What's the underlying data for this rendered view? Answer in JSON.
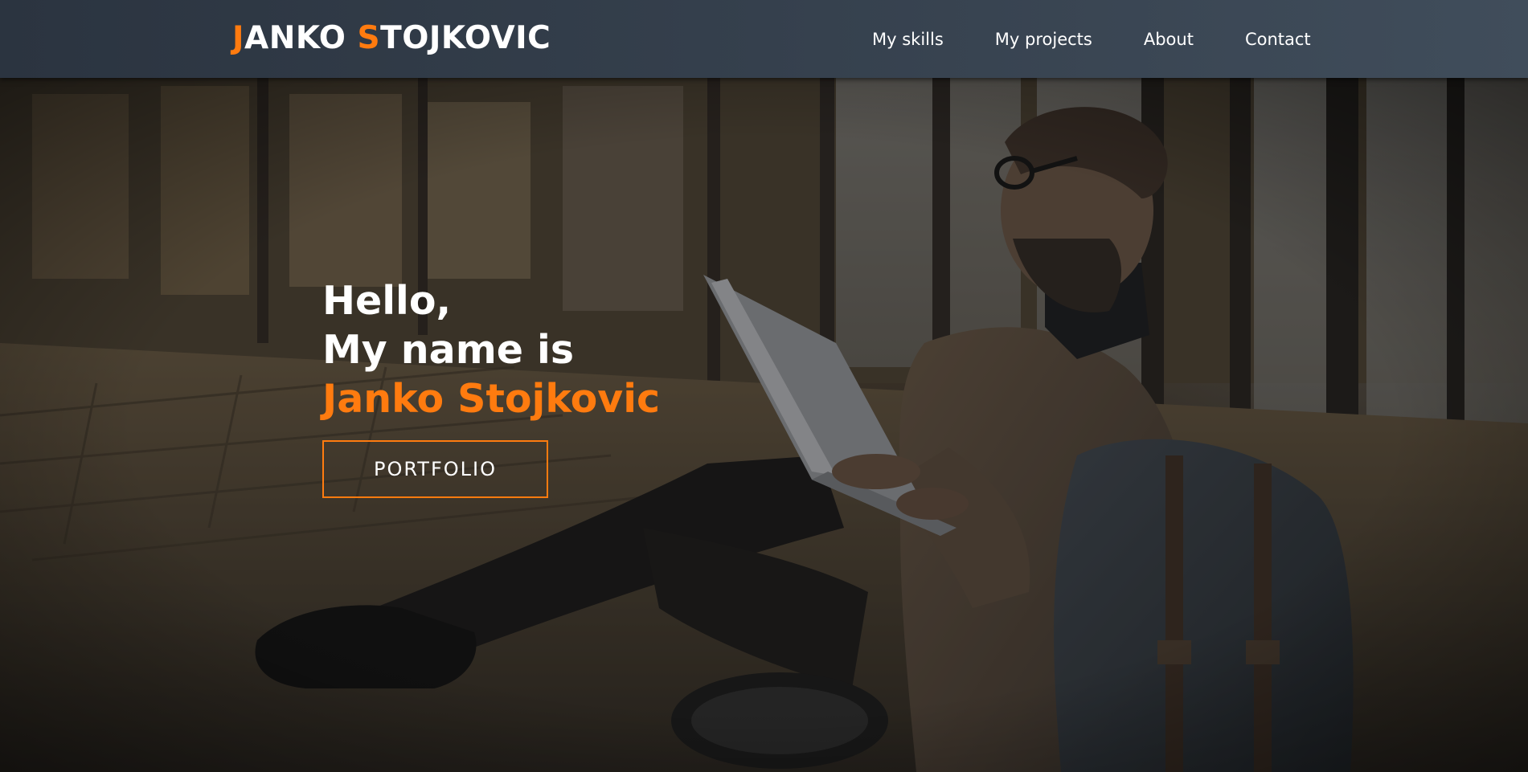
{
  "header": {
    "brand": {
      "first_initial": "J",
      "first_rest": "ANKO ",
      "last_initial": "S",
      "last_rest": "TOJKOVIC"
    },
    "nav": [
      "My skills",
      "My projects",
      "About",
      "Contact"
    ]
  },
  "hero": {
    "line1": "Hello,",
    "line2": "My name is",
    "name": "Janko Stojkovic",
    "button_label": "PORTFOLIO"
  },
  "colors": {
    "accent": "#ff7b0f",
    "navbar": "#35404d",
    "text": "#ffffff"
  },
  "background_image": "hero-photo"
}
